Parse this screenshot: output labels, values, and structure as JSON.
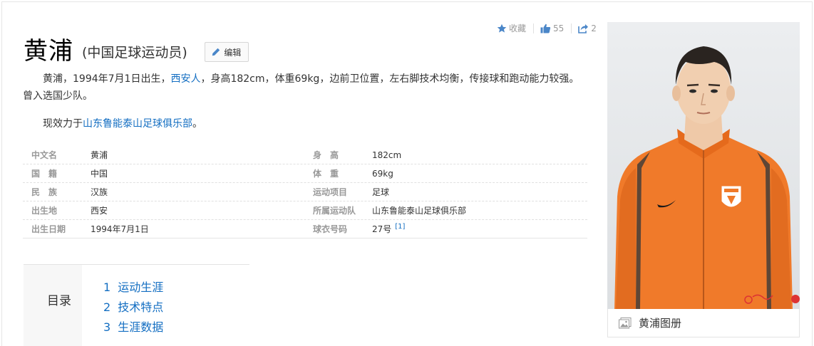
{
  "actions": {
    "collect_label": "收藏",
    "like_count": "55",
    "share_count": "2"
  },
  "header": {
    "title": "黄浦",
    "subtitle": "(中国足球运动员)",
    "edit_label": "编辑"
  },
  "summary": {
    "p1_a": "黄浦，1994年7月1日出生，",
    "p1_link": "西安人",
    "p1_b": "，身高182cm，体重69kg，边前卫位置，左右脚技术均衡，传接球和跑动能力较强。曾入选国少队。",
    "p2_a": "现效力于",
    "p2_link": "山东鲁能泰山足球俱乐部",
    "p2_b": "。"
  },
  "basic_info": [
    {
      "k1": "中文名",
      "v1": "黄浦",
      "k2": "身　高",
      "v2": "182cm"
    },
    {
      "k1": "国　籍",
      "v1": "中国",
      "k2": "体　重",
      "v2": "69kg"
    },
    {
      "k1": "民　族",
      "v1": "汉族",
      "k2": "运动项目",
      "v2": "足球"
    },
    {
      "k1": "出生地",
      "v1": "西安",
      "k2": "所属运动队",
      "v2": "山东鲁能泰山足球俱乐部"
    },
    {
      "k1": "出生日期",
      "v1": "1994年7月1日",
      "k2": "球衣号码",
      "v2": "27号",
      "ref": "[1]"
    }
  ],
  "catalog": {
    "title": "目录",
    "items": [
      {
        "num": "1",
        "label": "运动生涯"
      },
      {
        "num": "2",
        "label": "技术特点"
      },
      {
        "num": "3",
        "label": "生涯数据"
      }
    ]
  },
  "album": {
    "label": "黄浦图册"
  },
  "colors": {
    "link": "#136ec2",
    "jersey": "#f07a2a",
    "icon": "#4a86c8"
  }
}
